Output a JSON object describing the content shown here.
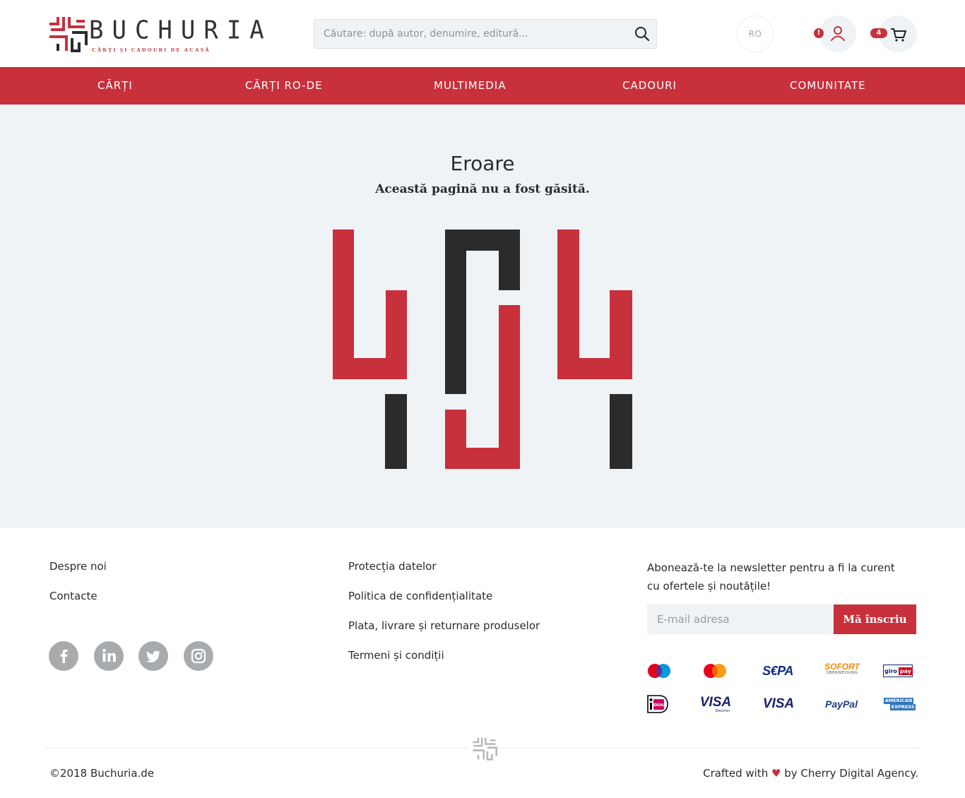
{
  "header": {
    "logo_word": "BUCHURIA",
    "logo_tagline": "CĂRȚI ȘI CADOURI DE ACASĂ",
    "search_placeholder": "Căutare: după autor, denumire, editură...",
    "language": "RO",
    "user_alert": "!",
    "cart_count": "4"
  },
  "nav": {
    "items": [
      {
        "label": "CĂRȚI"
      },
      {
        "label": "CĂRȚI RO-DE"
      },
      {
        "label": "MULTIMEDIA"
      },
      {
        "label": "CADOURI"
      },
      {
        "label": "COMUNITATE"
      }
    ]
  },
  "error": {
    "title": "Eroare",
    "subtitle": "Această pagină nu a fost găsită."
  },
  "footer": {
    "col1": [
      "Despre noi",
      "Contacte"
    ],
    "col2": [
      "Protecția datelor",
      "Politica de confidențialitate",
      "Plata, livrare și returnare produselor",
      "Termeni și condiții"
    ],
    "social": [
      "facebook-icon",
      "linkedin-icon",
      "twitter-icon",
      "instagram-icon"
    ],
    "newsletter_text": "Abonează-te la newsletter pentru a fi la curent cu ofertele și noutățile!",
    "email_placeholder": "E-mail adresa",
    "subscribe_label": "Mă înscriu",
    "payments": {
      "sepa": "S€PA",
      "sofort": "SOFORT",
      "sofort_sub": "ÜBERWEISUNG",
      "giro_a": "giro",
      "giro_b": "pay",
      "ideal": "iDEAL",
      "visa": "VISA",
      "visa_sub": "Electron",
      "paypal": "PayPal",
      "amex_a": "AMERICAN",
      "amex_b": "EXPRESS"
    },
    "copyright": "©2018 Buchuria.de",
    "crafted_pre": "Crafted with",
    "crafted_heart": "♥",
    "crafted_post": "by Cherry Digital Agency."
  },
  "colors": {
    "brand_red": "#c8303c",
    "dark": "#2b2b2b",
    "bg_light": "#f0f3f6"
  }
}
